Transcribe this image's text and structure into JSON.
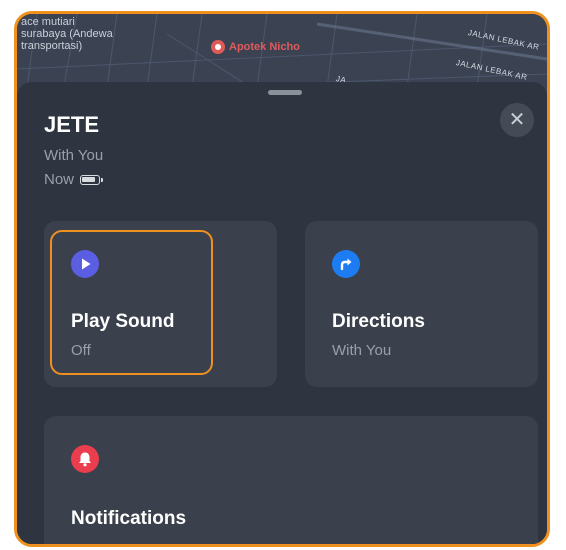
{
  "map": {
    "place_label": "ace mutiari\nsurabaya (Andewa\ntransportasi)",
    "poi_label": "Apotek Nicho",
    "road_labels": [
      "JALAN LEBAK AR",
      "JALAN LEBAK AR",
      "JA"
    ]
  },
  "device": {
    "name": "JETE",
    "status": "With You",
    "time": "Now"
  },
  "actions": {
    "play_sound": {
      "title": "Play Sound",
      "subtitle": "Off"
    },
    "directions": {
      "title": "Directions",
      "subtitle": "With You"
    },
    "notifications": {
      "title": "Notifications"
    }
  },
  "colors": {
    "highlight": "#f0901e",
    "play": "#5b5ee0",
    "directions": "#1e7cf2",
    "notifications": "#ea3d4d",
    "poi": "#e05a5a"
  },
  "icons": {
    "close": "close-icon",
    "battery": "battery-icon",
    "play": "play-icon",
    "directions": "directions-arrow-icon",
    "bell": "bell-icon",
    "poi": "pharmacy-pin-icon"
  }
}
